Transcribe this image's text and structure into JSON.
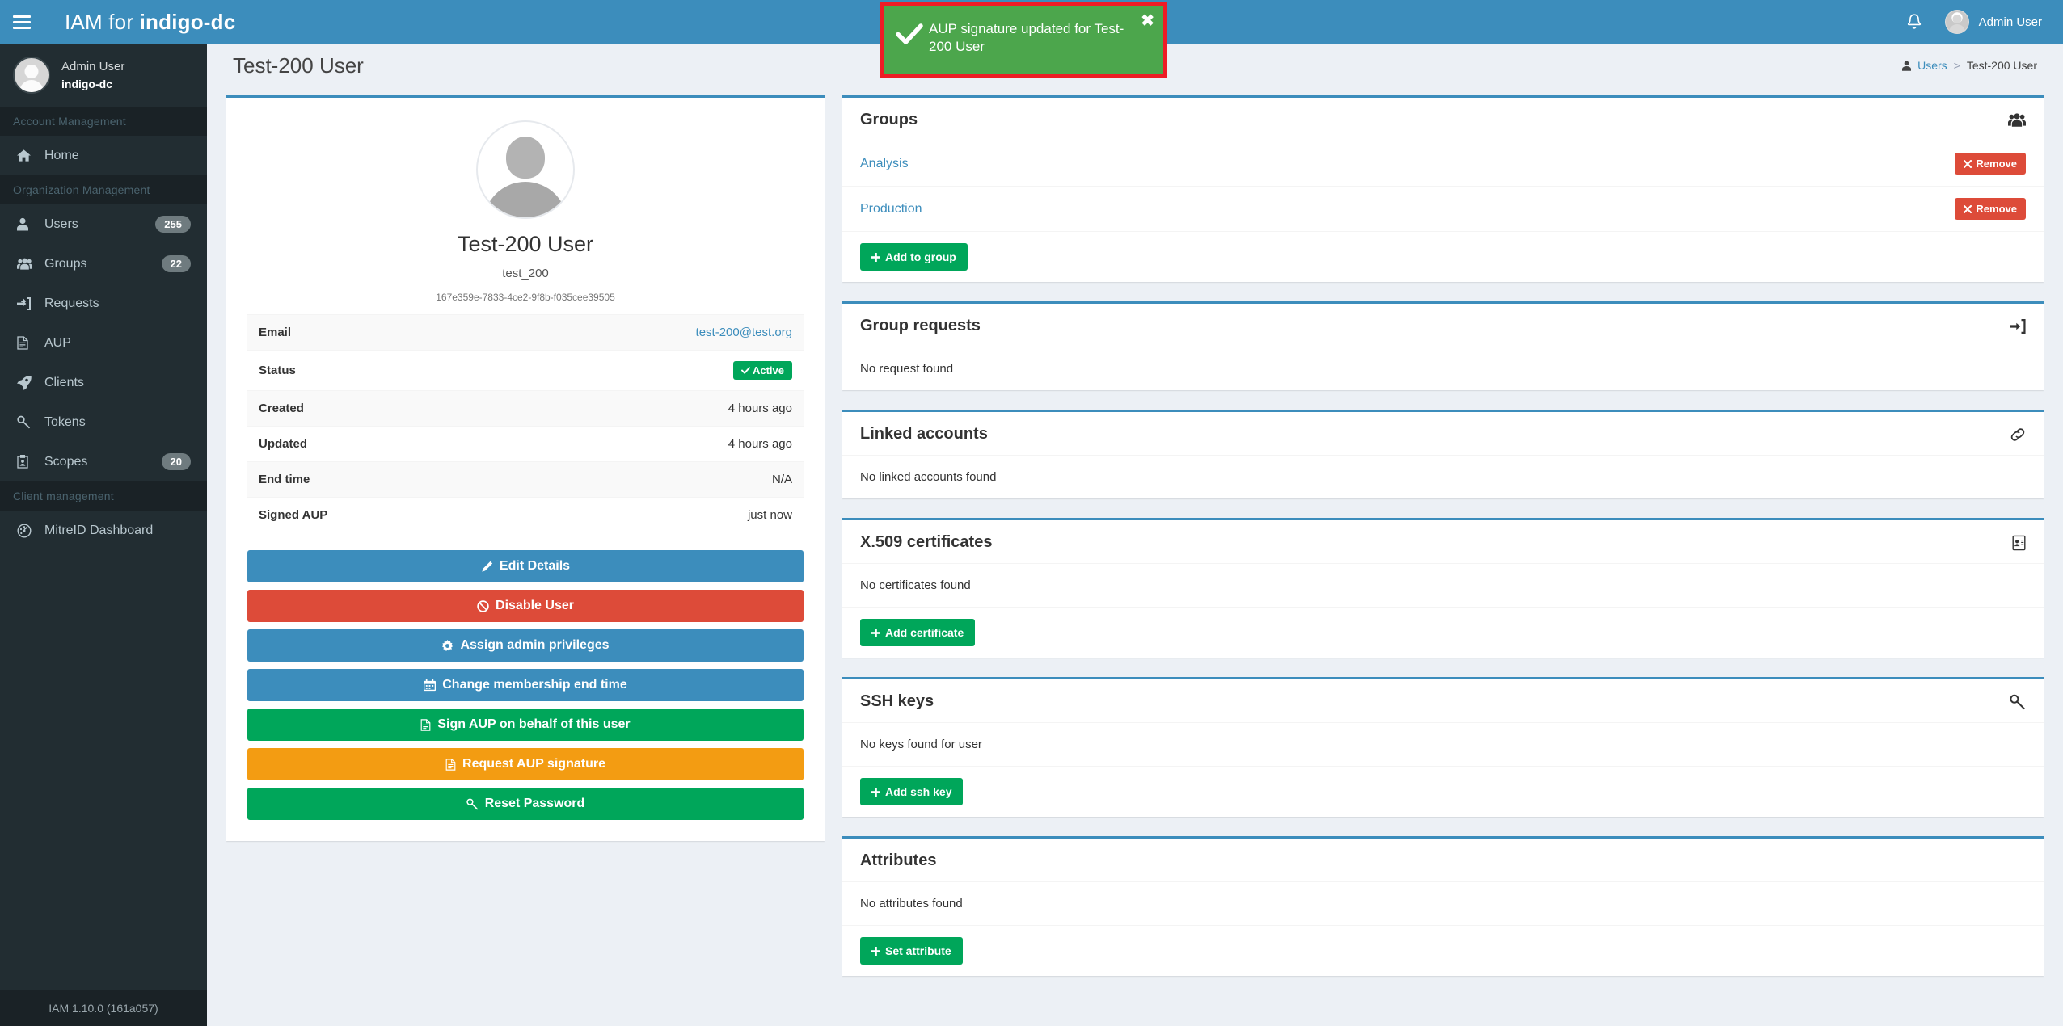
{
  "navbar": {
    "brand_prefix": "IAM for ",
    "brand_org": "indigo-dc",
    "toggle_icon": "hamburger-menu-icon",
    "bell_icon": "bell-icon",
    "user_name": "Admin User"
  },
  "sidebar": {
    "user": {
      "name": "Admin User",
      "org": "indigo-dc"
    },
    "sections": [
      {
        "header": "Account Management",
        "items": [
          {
            "label": "Home",
            "icon": "home-icon",
            "badge": ""
          }
        ]
      },
      {
        "header": "Organization Management",
        "items": [
          {
            "label": "Users",
            "icon": "user-icon",
            "badge": "255"
          },
          {
            "label": "Groups",
            "icon": "users-group-icon",
            "badge": "22"
          },
          {
            "label": "Requests",
            "icon": "sign-in-icon",
            "badge": ""
          },
          {
            "label": "AUP",
            "icon": "file-text-icon",
            "badge": ""
          },
          {
            "label": "Clients",
            "icon": "rocket-icon",
            "badge": ""
          },
          {
            "label": "Tokens",
            "icon": "key-icon",
            "badge": ""
          },
          {
            "label": "Scopes",
            "icon": "id-card-icon",
            "badge": "20"
          }
        ]
      },
      {
        "header": "Client management",
        "items": [
          {
            "label": "MitreID Dashboard",
            "icon": "dashboard-icon",
            "badge": ""
          }
        ]
      }
    ],
    "footer": "IAM 1.10.0 (161a057)"
  },
  "content_header": {
    "page_title": "Test-200 User",
    "breadcrumb": {
      "icon": "user-icon",
      "root": "Users",
      "separator": ">",
      "current": "Test-200 User"
    }
  },
  "toast": {
    "icon": "check-icon",
    "message": "AUP signature updated for Test-200 User",
    "close_label": "✖",
    "bg_color": "#4ca64c",
    "highlight_border_color": "#ee1c25"
  },
  "profile": {
    "avatar_icon": "default-user-avatar",
    "name": "Test-200 User",
    "username": "test_200",
    "uuid": "167e359e-7833-4ce2-9f8b-f035cee39505",
    "rows": [
      {
        "key": "Email",
        "value": "test-200@test.org",
        "type": "link"
      },
      {
        "key": "Status",
        "value": "Active",
        "type": "badge",
        "badge_icon": "check-icon"
      },
      {
        "key": "Created",
        "value": "4 hours ago",
        "type": "text"
      },
      {
        "key": "Updated",
        "value": "4 hours ago",
        "type": "text"
      },
      {
        "key": "End time",
        "value": "N/A",
        "type": "text"
      },
      {
        "key": "Signed AUP",
        "value": "just now",
        "type": "text"
      }
    ],
    "actions": [
      {
        "label": "Edit Details",
        "icon": "pencil-icon",
        "color": "#3c8dbc",
        "class": "bg-blue"
      },
      {
        "label": "Disable User",
        "icon": "ban-icon",
        "color": "#dd4b39",
        "class": "bg-red"
      },
      {
        "label": "Assign admin privileges",
        "icon": "gear-icon",
        "color": "#3c8dbc",
        "class": "bg-blue"
      },
      {
        "label": "Change membership end time",
        "icon": "calendar-icon",
        "color": "#3c8dbc",
        "class": "bg-blue"
      },
      {
        "label": "Sign AUP on behalf of this user",
        "icon": "file-text-icon",
        "color": "#00a65a",
        "class": "bg-green"
      },
      {
        "label": "Request AUP signature",
        "icon": "file-text-icon",
        "color": "#f39c12",
        "class": "bg-orange"
      },
      {
        "label": "Reset Password",
        "icon": "key-icon",
        "color": "#00a65a",
        "class": "bg-green"
      }
    ]
  },
  "panels": {
    "groups": {
      "title": "Groups",
      "icon": "users-group-icon",
      "rows": [
        {
          "name": "Analysis",
          "action_label": "Remove",
          "action_icon": "times-icon"
        },
        {
          "name": "Production",
          "action_label": "Remove",
          "action_icon": "times-icon"
        }
      ],
      "add_button": {
        "label": "Add to group",
        "icon": "plus-icon"
      }
    },
    "group_requests": {
      "title": "Group requests",
      "icon": "sign-in-icon",
      "empty": "No request found"
    },
    "linked_accounts": {
      "title": "Linked accounts",
      "icon": "link-icon",
      "empty": "No linked accounts found"
    },
    "x509": {
      "title": "X.509 certificates",
      "icon": "id-card-icon",
      "empty": "No certificates found",
      "add_button": {
        "label": "Add certificate",
        "icon": "plus-icon"
      }
    },
    "ssh_keys": {
      "title": "SSH keys",
      "icon": "key-icon",
      "empty": "No keys found for user",
      "add_button": {
        "label": "Add ssh key",
        "icon": "plus-icon"
      }
    },
    "attributes": {
      "title": "Attributes",
      "icon": "",
      "empty": "No attributes found",
      "add_button": {
        "label": "Set attribute",
        "icon": "plus-icon"
      }
    }
  },
  "theme": {
    "navbar_blue": "#3c8dbc",
    "sidebar_dark": "#222d32",
    "sidebar_header": "#1a2226",
    "page_bg": "#ecf0f5",
    "green": "#00a65a",
    "red": "#dd4b39",
    "orange": "#f39c12"
  }
}
